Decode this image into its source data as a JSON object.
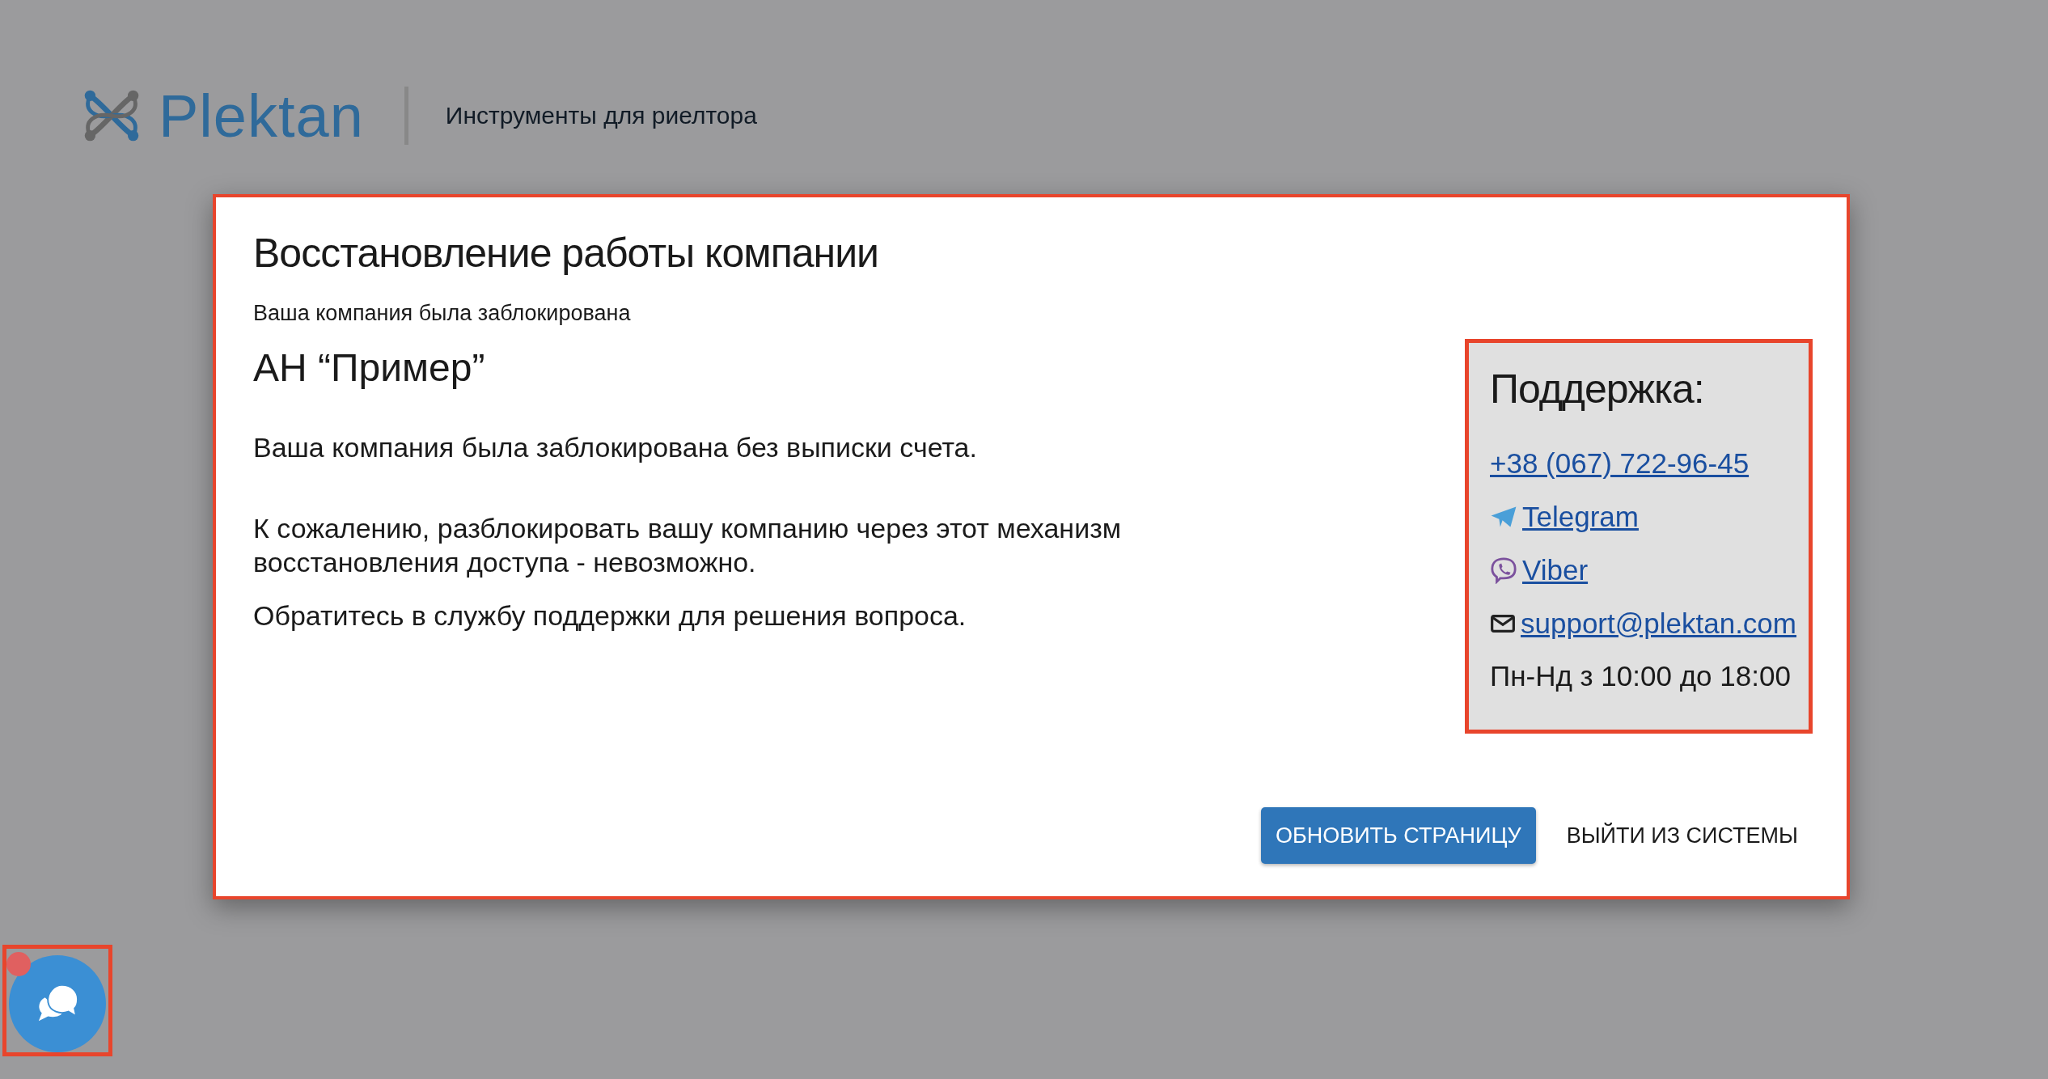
{
  "header": {
    "brand": "Plektan",
    "tagline": "Инструменты для риелтора"
  },
  "dialog": {
    "title": "Восстановление работы компании",
    "subtitle": "Ваша компания была заблокирована",
    "company": "АН “Пример”",
    "paragraphs": [
      "Ваша компания была заблокирована без выписки счета.",
      "К сожалению, разблокировать вашу компанию через этот механизм восстановления доступа - невозможно.",
      "Обратитесь в службу поддержки для решения вопроса."
    ],
    "support": {
      "title": "Поддержка:",
      "contacts": [
        {
          "kind": "phone",
          "text": "+38 (067) 722-96-45"
        },
        {
          "kind": "telegram",
          "text": "Telegram"
        },
        {
          "kind": "viber",
          "text": "Viber"
        },
        {
          "kind": "email",
          "text": "support@plektan.com"
        }
      ],
      "hours": "Пн-Нд з 10:00 до 18:00"
    },
    "buttons": [
      {
        "kind": "primary",
        "label": "ОБНОВИТЬ СТРАНИЦУ"
      },
      {
        "kind": "text",
        "label": "ВЫЙТИ ИЗ СИСТЕМЫ"
      }
    ]
  },
  "chat_button": {
    "has_badge": true
  }
}
